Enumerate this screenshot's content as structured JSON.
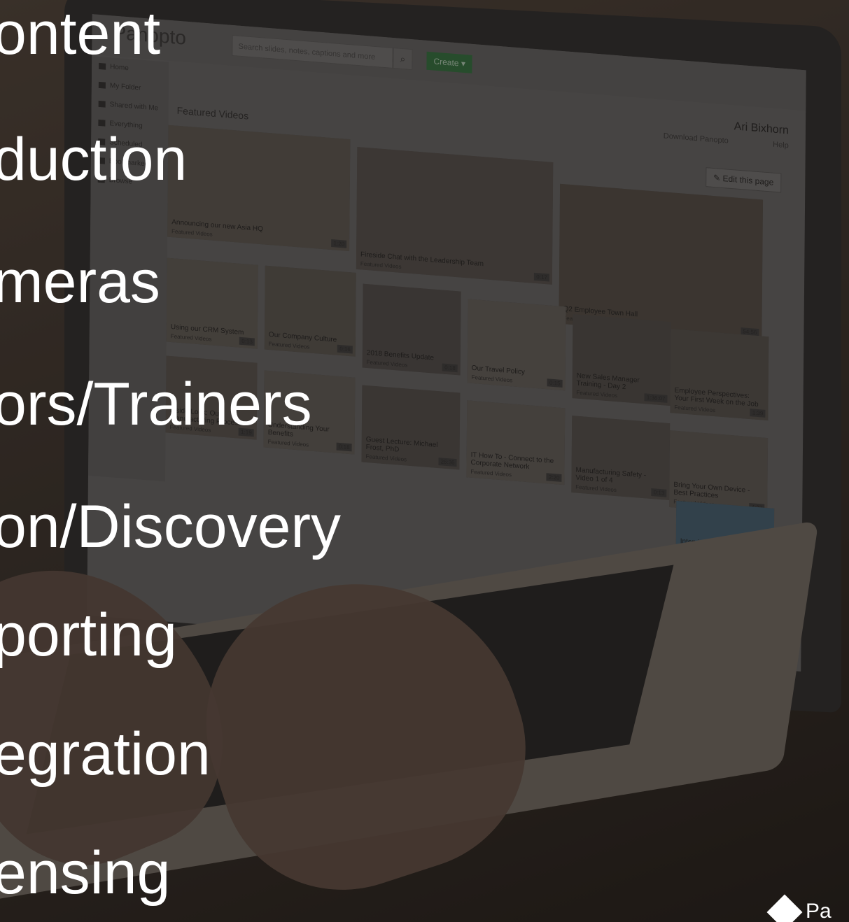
{
  "overlay_items": [
    "ontent",
    "duction",
    "meras",
    "ors/Trainers",
    "on/Discovery",
    "porting",
    "egration",
    "ensing"
  ],
  "app": {
    "logo": "Panopto",
    "search_placeholder": "Search slides, notes, captions and more",
    "create_label": "Create ▾",
    "user_name": "Ari Bixhorn",
    "download_link": "Download Panopto",
    "help_link": "Help",
    "edit_label": "Edit this page",
    "featured_title": "Featured Videos"
  },
  "sidebar": {
    "items": [
      {
        "label": "Home"
      },
      {
        "label": "My Folder"
      },
      {
        "label": "Shared with Me"
      },
      {
        "label": "Everything"
      },
      {
        "label": "Scheduled"
      },
      {
        "label": "Bookmarked"
      },
      {
        "label": "Browse"
      }
    ]
  },
  "videos": [
    {
      "title": "Announcing our new Asia HQ",
      "subtitle": "Featured Videos",
      "duration": "1:20"
    },
    {
      "title": "Fireside Chat with the Leadership Team",
      "subtitle": "Featured Videos",
      "duration": "0:17"
    },
    {
      "title": "Q2 Employee Town Hall",
      "subtitle": "Featured Videos",
      "duration": "54:56"
    },
    {
      "title": "Using our CRM System",
      "subtitle": "Featured Videos",
      "duration": "0:13"
    },
    {
      "title": "Our Company Culture",
      "subtitle": "Featured Videos",
      "duration": "0:16"
    },
    {
      "title": "2018 Benefits Update",
      "subtitle": "Featured Videos",
      "duration": "0:18"
    },
    {
      "title": "Our Travel Policy",
      "subtitle": "Featured Videos",
      "duration": "0:15"
    },
    {
      "title": "New Sales Manager Training - Day 2",
      "subtitle": "Featured Videos",
      "duration": "1:36:07"
    },
    {
      "title": "Employee Perspectives: Your First Week on the Job",
      "subtitle": "Featured Videos",
      "duration": "1:39"
    },
    {
      "title": "Inside Look: Our Manufacturing Process",
      "subtitle": "Featured Videos",
      "duration": "1:19"
    },
    {
      "title": "Understanding Your Benefits",
      "subtitle": "Featured Videos",
      "duration": "0:18"
    },
    {
      "title": "Guest Lecture: Michael Frost, PhD",
      "subtitle": "Featured Videos",
      "duration": "26:36"
    },
    {
      "title": "IT How To - Connect to the Corporate Network",
      "subtitle": "Featured Videos",
      "duration": "2:20"
    },
    {
      "title": "Manufacturing Safety - Video 1 of 4",
      "subtitle": "Featured Videos",
      "duration": "0:13"
    },
    {
      "title": "Bring Your Own Device - Best Practices",
      "subtitle": "Featured Videos",
      "duration": "4:32"
    },
    {
      "title": "Interview Tips For Hiring Managers",
      "subtitle": "",
      "duration": ""
    }
  ],
  "brand": {
    "label": "Pa"
  },
  "colors": {
    "overlay_text": "#ffffff",
    "create_button": "#2f6b3b",
    "background": "#2c2621"
  }
}
